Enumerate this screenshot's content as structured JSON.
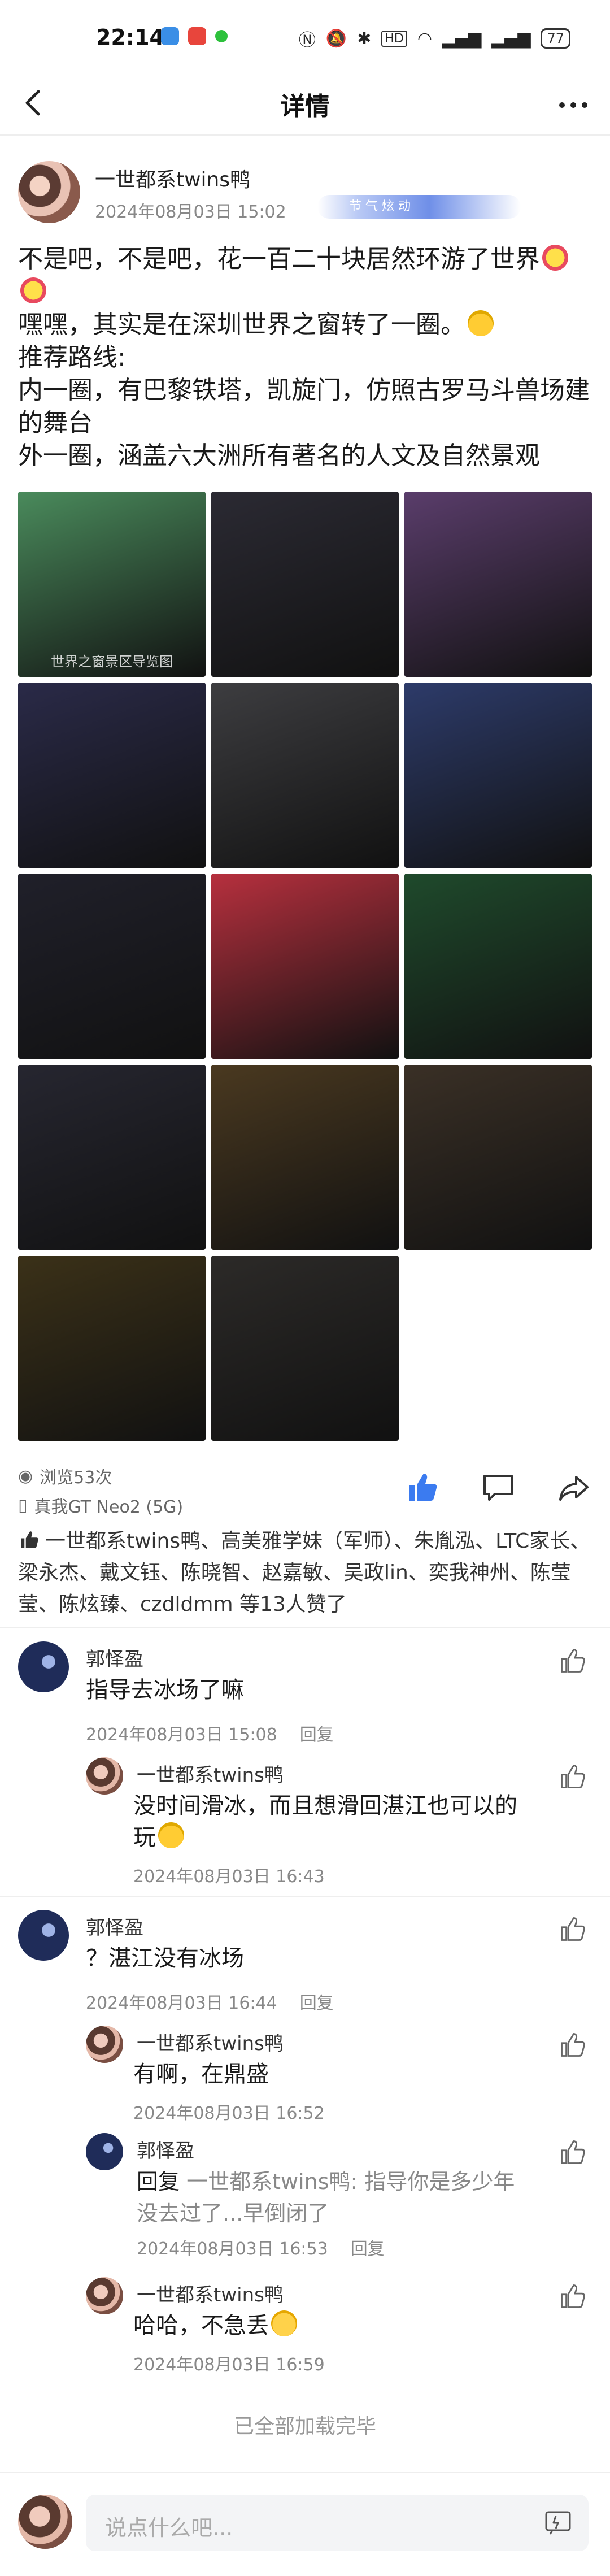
{
  "status": {
    "time": "22:14",
    "battery": "77"
  },
  "nav": {
    "title": "详情"
  },
  "post": {
    "author": "一世都系twins鸭",
    "time": "2024年08月03日 15:02",
    "badge": "节 气 炫 动",
    "lines": [
      "不是吧，不是吧，花一百二十块居然环游了世界",
      "嘿嘿，其实是在深圳世界之窗转了一圈。",
      "推荐路线:",
      "内一圈，有巴黎铁塔，凯旋门，仿照古罗马斗兽场建的舞台",
      "外一圈，涵盖六大洲所有著名的人文及自然景观"
    ],
    "photos": [
      {
        "label": "世界之窗景区导览图",
        "color": "#4a8b5c"
      },
      {
        "label": "",
        "color": "#2b2a33"
      },
      {
        "label": "",
        "color": "#5a3d6b"
      },
      {
        "label": "",
        "color": "#2a2a48"
      },
      {
        "label": "",
        "color": "#3d3d40"
      },
      {
        "label": "",
        "color": "#2d3b6a"
      },
      {
        "label": "",
        "color": "#20202a"
      },
      {
        "label": "",
        "color": "#b7303e"
      },
      {
        "label": "",
        "color": "#1f4a2c"
      },
      {
        "label": "",
        "color": "#262630"
      },
      {
        "label": "",
        "color": "#4a3920"
      },
      {
        "label": "",
        "color": "#3a3026"
      },
      {
        "label": "",
        "color": "#3b3118"
      },
      {
        "label": "",
        "color": "#2c2a28"
      }
    ],
    "views": "浏览53次",
    "device": "真我GT Neo2 (5G)",
    "likes": "一世都系twins鸭、高美雅学妹（军师）、朱胤泓、LTC家长、梁永杰、戴文钰、陈晓智、赵嘉敏、吴政lin、奕我神州、陈莹莹、陈炫臻、czdldmm 等13人赞了"
  },
  "comments": [
    {
      "author": "郭怿盈",
      "text": "指导去冰场了嘛",
      "time": "2024年08月03日 15:08",
      "reply": "回复"
    },
    {
      "author": "一世都系twins鸭",
      "text": "没时间滑冰，而且想滑回湛江也可以的玩",
      "time": "2024年08月03日 16:43"
    },
    {
      "author": "郭怿盈",
      "text": "？湛江没有冰场",
      "time": "2024年08月03日 16:44",
      "reply": "回复"
    },
    {
      "author": "一世都系twins鸭",
      "text": "有啊，在鼎盛",
      "time": "2024年08月03日 16:52"
    },
    {
      "author": "郭怿盈",
      "reply_prefix": "回复",
      "quote": "一世都系twins鸭: 指导你是多少年没去过了...早倒闭了",
      "time": "2024年08月03日 16:53",
      "reply": "回复"
    },
    {
      "author": "一世都系twins鸭",
      "text": "哈哈，不急丢",
      "time": "2024年08月03日 16:59"
    }
  ],
  "footer": {
    "loaded": "已全部加载完毕",
    "input_placeholder": "说点什么吧..."
  },
  "colors": {
    "accent": "#3b7bf0"
  }
}
